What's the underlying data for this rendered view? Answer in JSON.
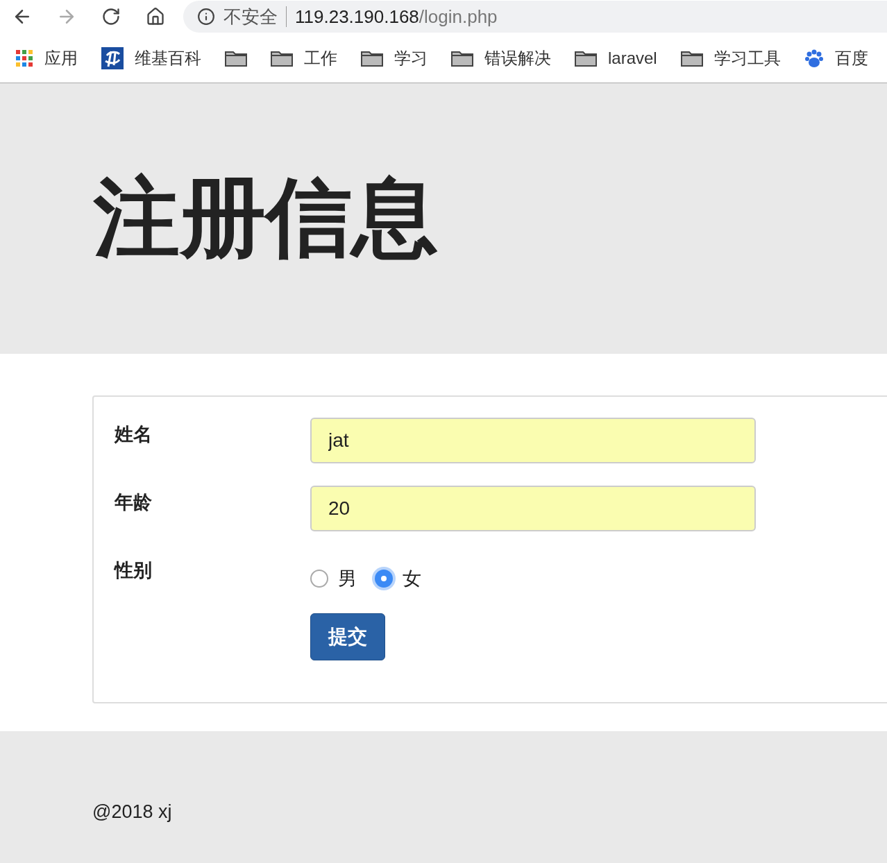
{
  "browser": {
    "security_label": "不安全",
    "url_host": "119.23.190.168",
    "url_path": "/login.php"
  },
  "bookmarks": [
    {
      "kind": "apps",
      "label": "应用"
    },
    {
      "kind": "site",
      "label": "维基百科"
    },
    {
      "kind": "folder"
    },
    {
      "kind": "folder",
      "label": "工作"
    },
    {
      "kind": "folder",
      "label": "学习"
    },
    {
      "kind": "folder",
      "label": "错误解决"
    },
    {
      "kind": "folder",
      "label": "laravel"
    },
    {
      "kind": "folder",
      "label": "学习工具"
    },
    {
      "kind": "paw",
      "label": "百度"
    }
  ],
  "page_title": "注册信息",
  "form": {
    "fields": [
      {
        "label": "姓名",
        "value": "jat"
      },
      {
        "label": "年龄",
        "value": "20"
      }
    ],
    "gender": {
      "label": "性别",
      "options": [
        {
          "label": "男",
          "selected": false
        },
        {
          "label": "女",
          "selected": true
        }
      ]
    },
    "submit": "提交"
  },
  "footer": "@2018 xj"
}
